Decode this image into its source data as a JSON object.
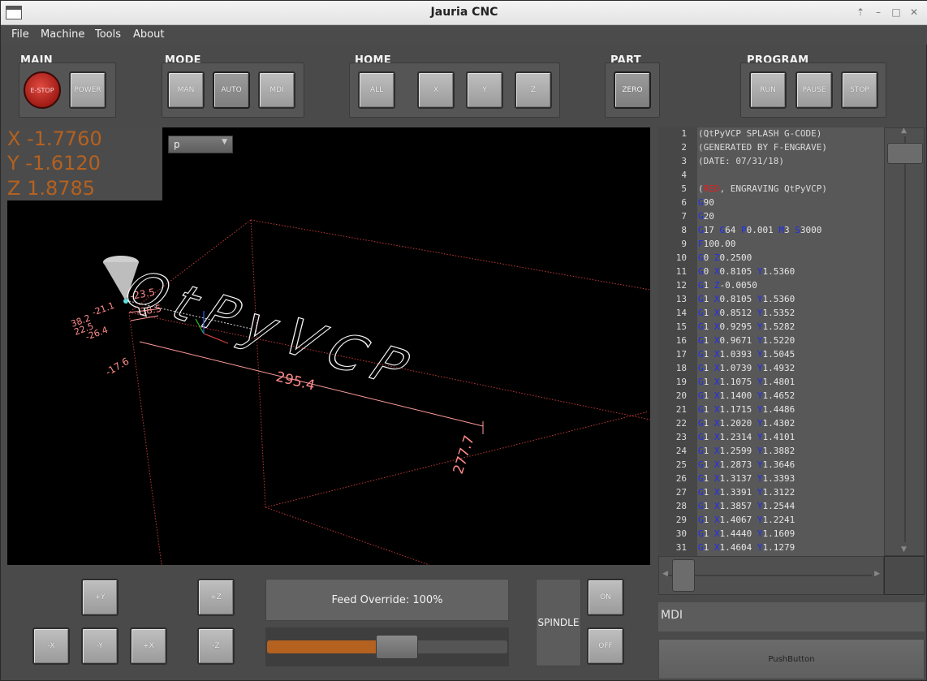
{
  "window": {
    "title": "Jauria CNC",
    "controls": [
      "⇡",
      "–",
      "□",
      "✕"
    ]
  },
  "menu": {
    "items": [
      "File",
      "Machine",
      "Tools",
      "About"
    ]
  },
  "groups": {
    "main": {
      "label": "MAIN",
      "estop": "E-STOP",
      "power": "POWER"
    },
    "mode": {
      "label": "MODE",
      "man": "MAN",
      "auto": "AUTO",
      "mdi": "MDI"
    },
    "home": {
      "label": "HOME",
      "all": "ALL",
      "x": "X",
      "y": "Y",
      "z": "Z"
    },
    "part": {
      "label": "PART",
      "zero": "ZERO"
    },
    "program": {
      "label": "PROGRAM",
      "run": "RUN",
      "pause": "PAUSE",
      "stop": "STOP"
    }
  },
  "dro": {
    "x": "X -1.7760",
    "y": "Y -1.6120",
    "z": "Z 1.8785",
    "color": "#b5611f"
  },
  "view_select": {
    "value": "p"
  },
  "viewport": {
    "text": "QtPyVCP",
    "dim_x": "295.4",
    "dim_y": "277.7",
    "dim_small": [
      "-17.6",
      "-23.5",
      "-38.5",
      "38.2",
      "-21.1",
      "22.5",
      "-26.4"
    ]
  },
  "gcode": {
    "lines": [
      {
        "n": "1",
        "code": "(QtPyVCP SPLASH G-CODE)"
      },
      {
        "n": "2",
        "code": "(GENERATED BY F-ENGRAVE)"
      },
      {
        "n": "3",
        "code": "(DATE: 07/31/18)"
      },
      {
        "n": "4",
        "code": ""
      },
      {
        "n": "5",
        "code": "(RED, ENGRAVING QtPyVCP)"
      },
      {
        "n": "6",
        "code": "G90"
      },
      {
        "n": "7",
        "code": "G20"
      },
      {
        "n": "8",
        "code": "G17 G64 P0.001 M3 S3000"
      },
      {
        "n": "9",
        "code": "F100.00"
      },
      {
        "n": "10",
        "code": "G0 Z0.2500"
      },
      {
        "n": "11",
        "code": "G0 X0.8105 Y1.5360"
      },
      {
        "n": "12",
        "code": "G1 Z-0.0050"
      },
      {
        "n": "13",
        "code": "G1 X0.8105 Y1.5360"
      },
      {
        "n": "14",
        "code": "G1 X0.8512 Y1.5352"
      },
      {
        "n": "15",
        "code": "G1 X0.9295 Y1.5282"
      },
      {
        "n": "16",
        "code": "G1 X0.9671 Y1.5220"
      },
      {
        "n": "17",
        "code": "G1 X1.0393 Y1.5045"
      },
      {
        "n": "18",
        "code": "G1 X1.0739 Y1.4932"
      },
      {
        "n": "19",
        "code": "G1 X1.1075 Y1.4801"
      },
      {
        "n": "20",
        "code": "G1 X1.1400 Y1.4652"
      },
      {
        "n": "21",
        "code": "G1 X1.1715 Y1.4486"
      },
      {
        "n": "22",
        "code": "G1 X1.2020 Y1.4302"
      },
      {
        "n": "23",
        "code": "G1 X1.2314 Y1.4101"
      },
      {
        "n": "24",
        "code": "G1 X1.2599 Y1.3882"
      },
      {
        "n": "25",
        "code": "G1 X1.2873 Y1.3646"
      },
      {
        "n": "26",
        "code": "G1 X1.3137 Y1.3393"
      },
      {
        "n": "27",
        "code": "G1 X1.3391 Y1.3122"
      },
      {
        "n": "28",
        "code": "G1 X1.3857 Y1.2544"
      },
      {
        "n": "29",
        "code": "G1 X1.4067 Y1.2241"
      },
      {
        "n": "30",
        "code": "G1 X1.4440 Y1.1609"
      },
      {
        "n": "31",
        "code": "G1 X1.4604 Y1.1279"
      }
    ]
  },
  "jog": {
    "plus_y": "+Y",
    "minus_y": "-Y",
    "plus_x": "+X",
    "minus_x": "-X",
    "plus_z": "+Z",
    "minus_z": "-Z"
  },
  "feed_override": {
    "label": "Feed Override: 100%",
    "value_fraction": 0.46
  },
  "spindle": {
    "label": "SPINDLE",
    "on": "ON",
    "off": "OFF"
  },
  "mdi": {
    "label": "MDI"
  },
  "push_button": {
    "label": "PushButton"
  }
}
